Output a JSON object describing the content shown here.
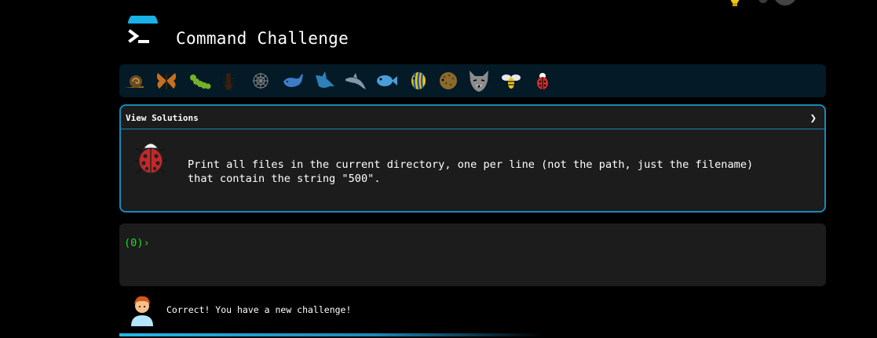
{
  "header": {
    "title": "Command Challenge"
  },
  "levels": [
    {
      "icon": "snail-icon"
    },
    {
      "icon": "butterfly-icon"
    },
    {
      "icon": "caterpillar-icon"
    },
    {
      "icon": "ant-icon"
    },
    {
      "icon": "spider-web-icon"
    },
    {
      "icon": "whale-icon"
    },
    {
      "icon": "shark-icon"
    },
    {
      "icon": "dolphin-icon"
    },
    {
      "icon": "fish-icon"
    },
    {
      "icon": "tropical-fish-icon"
    },
    {
      "icon": "blowfish-icon"
    },
    {
      "icon": "wolf-icon"
    },
    {
      "icon": "honeybee-icon"
    },
    {
      "icon": "ladybug-icon"
    }
  ],
  "challenge": {
    "view_solutions_label": "View Solutions",
    "chevron": "❯",
    "text": "Print all files in the current directory, one per line (not the path, just the filename)\nthat contain the string \"500\"."
  },
  "terminal": {
    "prompt": "(0)›"
  },
  "status": {
    "message": "Correct! You have a new challenge!"
  },
  "colors": {
    "accent": "#1a88b8",
    "prompt": "#19e019",
    "bar_bg": "#041a26",
    "panel_bg": "#1c1c1c"
  }
}
